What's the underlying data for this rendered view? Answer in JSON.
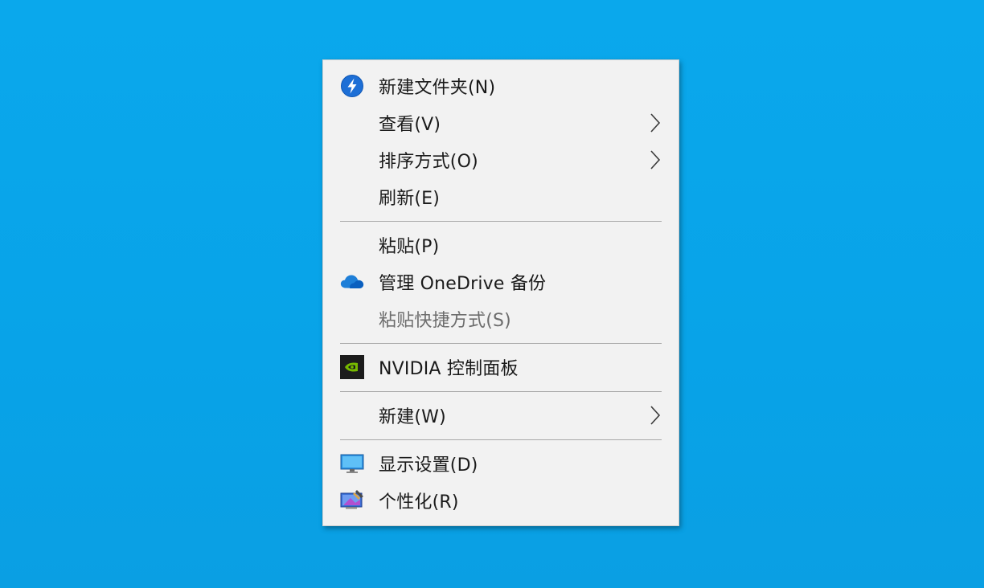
{
  "menu": {
    "items": [
      {
        "label": "新建文件夹(N)"
      },
      {
        "label": "查看(V)"
      },
      {
        "label": "排序方式(O)"
      },
      {
        "label": "刷新(E)"
      },
      {
        "label": "粘贴(P)"
      },
      {
        "label": "管理 OneDrive 备份"
      },
      {
        "label": "粘贴快捷方式(S)"
      },
      {
        "label": "NVIDIA 控制面板"
      },
      {
        "label": "新建(W)"
      },
      {
        "label": "显示设置(D)"
      },
      {
        "label": "个性化(R)"
      }
    ]
  },
  "icons": {
    "new_folder": "lightning-badge-icon",
    "onedrive": "cloud-icon",
    "nvidia": "nvidia-logo-icon",
    "display": "monitor-icon",
    "personalize": "paint-monitor-icon",
    "submenu": "chevron-right-icon"
  },
  "colors": {
    "desktop": "#0aa8ec",
    "menu_background": "#f2f2f2",
    "text": "#1a1a1a",
    "disabled_text": "#6d6d6d",
    "separator": "#a8a8a8",
    "onedrive_blue": "#1e7fd8",
    "nvidia_green": "#76b900"
  }
}
